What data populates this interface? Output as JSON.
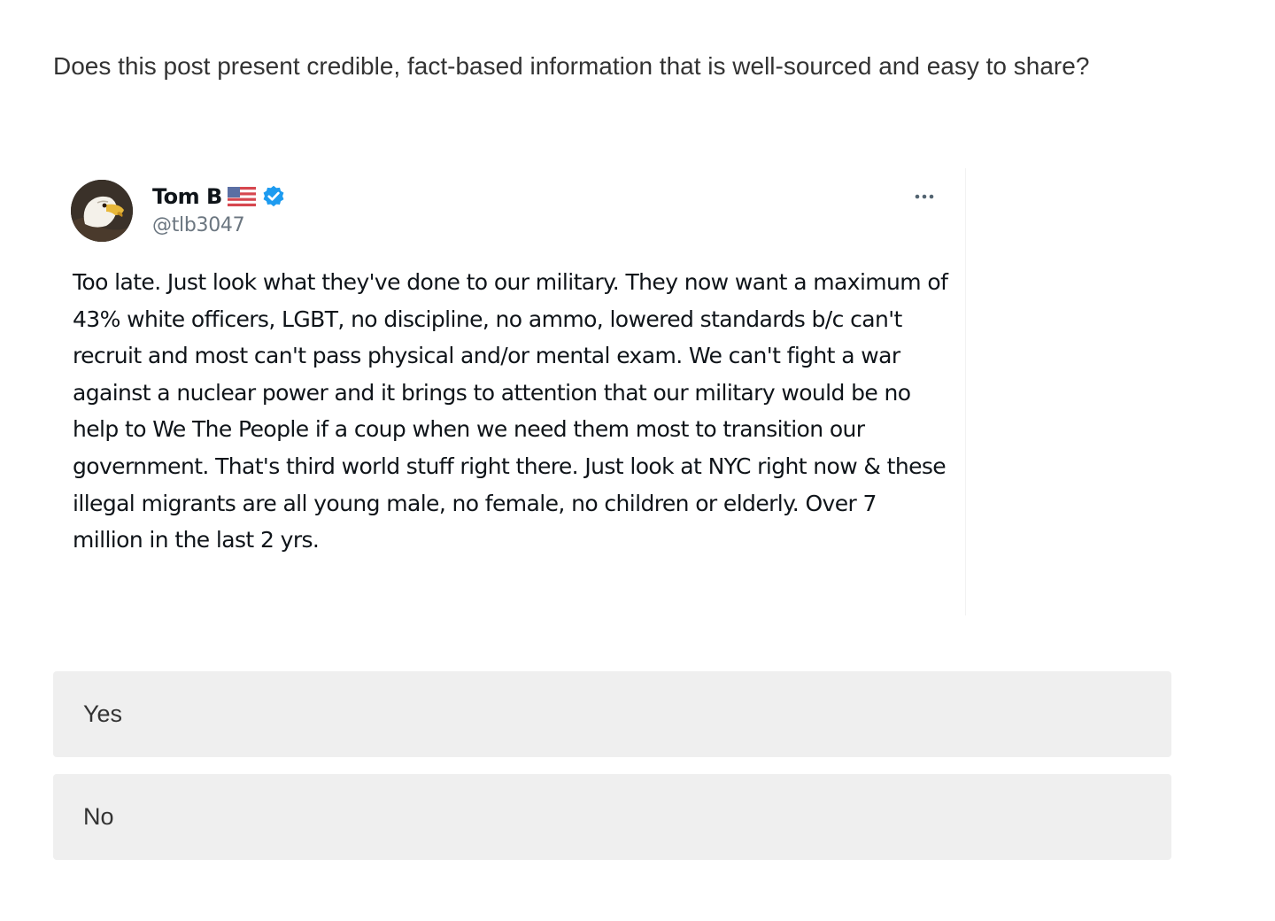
{
  "question": {
    "text": "Does this post present credible, fact-based information that is well-sourced and easy to share?"
  },
  "post": {
    "author": {
      "display_name": "Tom B",
      "handle": "@tlb3047",
      "avatar_icon": "bald-eagle-avatar",
      "flag_icon": "us-flag-icon",
      "verified_icon": "verified-badge-icon",
      "verified_color": "#1d9bf0"
    },
    "more_icon": "more-options-icon",
    "text": "Too late. Just look what they've done to our military. They now want a maximum of 43% white officers, LGBT, no discipline, no ammo, lowered standards b/c can't recruit and most can't pass physical and/or mental exam. We can't fight a war against a nuclear power and it brings to attention that our military would be no help to We The People if a coup when we need them most to transition our government. That's third world stuff right there. Just look at NYC right now & these illegal migrants are all young male, no female, no children or elderly. Over 7 million in the last 2 yrs."
  },
  "options": [
    {
      "label": "Yes"
    },
    {
      "label": "No"
    }
  ],
  "colors": {
    "option_background": "#efefef",
    "text_primary": "#0f1419",
    "text_secondary": "#6b7680"
  }
}
